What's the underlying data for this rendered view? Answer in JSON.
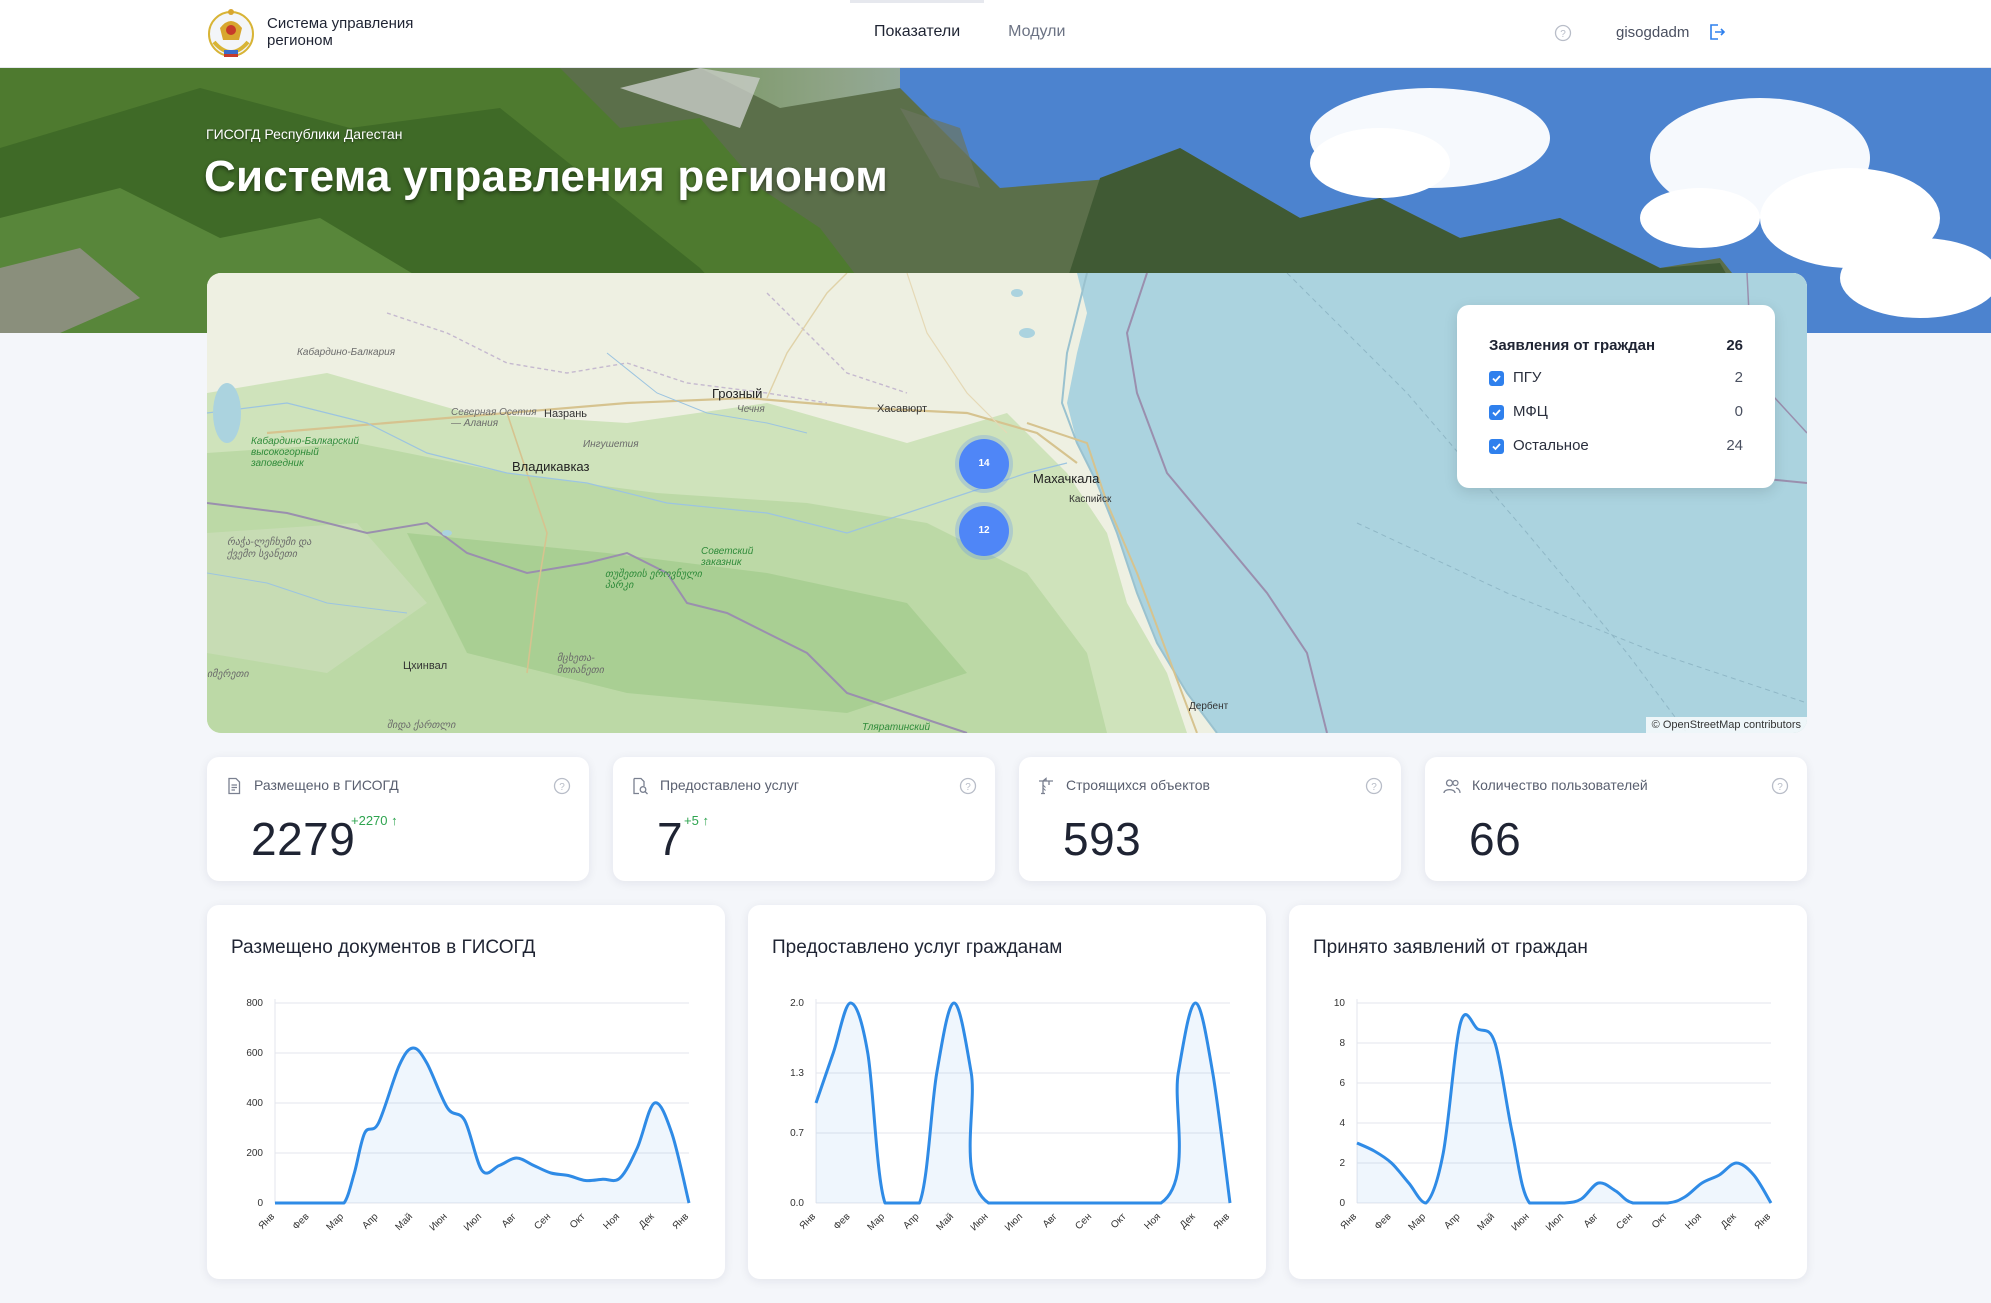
{
  "header": {
    "app_name": "Система управления регионом",
    "nav": [
      {
        "label": "Показатели",
        "active": true
      },
      {
        "label": "Модули",
        "active": false
      }
    ],
    "username": "gisogdadm",
    "icons": {
      "help": "help-circle-icon",
      "logout": "logout-icon",
      "logo": "dagestan-emblem-icon"
    }
  },
  "hero": {
    "subtitle": "ГИСОГД Республики Дагестан",
    "title": "Система управления регионом"
  },
  "map": {
    "labels": {
      "kbr": "Кабардино-Балкария",
      "grozny": "Грозный",
      "chechnya": "Чечня",
      "khasavyurt": "Хасавюрт",
      "nazran": "Назрань",
      "north_ossetia": "Северная Осетия — Алания",
      "ingushetia": "Ингушетия",
      "kbr_reserve": "Кабардино-Балкарский высокогорный заповедник",
      "vladikavkaz": "Владикавказ",
      "makhachkala": "Махачкала",
      "kaspiysk": "Каспийск",
      "sovetsky": "Советский заказник",
      "racha": "რაჭა-ლეჩხუმი და ქვემო სვანეთი",
      "tusheti": "თუშეთის ეროვნული პარკი",
      "mtskheta": "მცხეთა-მთიანეთი",
      "tskhinval": "Цхинвал",
      "imereti": "იმერეთი",
      "shida_kartli": "შიდა ქართლი",
      "derbent": "Дербент",
      "tlyaratinsky": "Тляратинский"
    },
    "clusters": [
      {
        "label": "14"
      },
      {
        "label": "12"
      }
    ],
    "attribution": "© OpenStreetMap contributors",
    "legend": {
      "title": "Заявления от граждан",
      "total": "26",
      "items": [
        {
          "label": "ПГУ",
          "value": "2",
          "checked": true
        },
        {
          "label": "МФЦ",
          "value": "0",
          "checked": true
        },
        {
          "label": "Остальное",
          "value": "24",
          "checked": true
        }
      ]
    }
  },
  "stats": [
    {
      "label": "Размещено в ГИСОГД",
      "value": "2279",
      "delta": "+2270",
      "icon": "document-icon"
    },
    {
      "label": "Предоставлено услуг",
      "value": "7",
      "delta": "+5",
      "icon": "document-search-icon"
    },
    {
      "label": "Строящихся объектов",
      "value": "593",
      "delta": "",
      "icon": "crane-icon"
    },
    {
      "label": "Количество пользователей",
      "value": "66",
      "delta": "",
      "icon": "users-icon"
    }
  ],
  "colors": {
    "accent": "#2f8be6",
    "delta_up": "#2ea44f",
    "cluster": "#4f86f7",
    "checkbox": "#2f80ed"
  },
  "chart_data": [
    {
      "type": "area",
      "title": "Размещено документов в ГИСОГД",
      "categories": [
        "Янв",
        "Фев",
        "Мар",
        "Апр",
        "Май",
        "Июн",
        "Июл",
        "Авг",
        "Сен",
        "Окт",
        "Ноя",
        "Дек",
        "Янв"
      ],
      "x": [
        0,
        1,
        1.6,
        2,
        2.3,
        2.6,
        3,
        3.6,
        4,
        4.4,
        5,
        5.5,
        6,
        6.5,
        7,
        7.5,
        8,
        8.5,
        9,
        9.5,
        10,
        10.5,
        11,
        11.5,
        12
      ],
      "values": [
        0,
        0,
        0,
        0,
        120,
        280,
        320,
        550,
        620,
        560,
        380,
        330,
        130,
        150,
        180,
        150,
        120,
        110,
        90,
        95,
        100,
        220,
        400,
        280,
        0
      ],
      "yticks": [
        "0",
        "200",
        "400",
        "600",
        "800"
      ],
      "ylim": [
        0,
        800
      ],
      "grid": true
    },
    {
      "type": "area",
      "title": "Предоставлено услуг гражданам",
      "categories": [
        "Янв",
        "Фев",
        "Мар",
        "Апр",
        "Май",
        "Июн",
        "Июл",
        "Авг",
        "Сен",
        "Окт",
        "Ноя",
        "Дек",
        "Янв"
      ],
      "x": [
        0,
        0.5,
        1,
        1.5,
        2,
        3,
        3.5,
        4,
        4.5,
        5,
        10,
        10.5,
        11,
        11.5,
        12
      ],
      "values": [
        1,
        1.5,
        2,
        1.5,
        0,
        0,
        1.3,
        2,
        1.3,
        0,
        0,
        1.3,
        2,
        1.3,
        0
      ],
      "yticks": [
        "0.0",
        "0.7",
        "1.3",
        "2.0"
      ],
      "ylim": [
        0,
        2
      ],
      "grid": true
    },
    {
      "type": "area",
      "title": "Принято заявлений от граждан",
      "categories": [
        "Янв",
        "Фев",
        "Мар",
        "Апр",
        "Май",
        "Июн",
        "Июл",
        "Авг",
        "Сен",
        "Окт",
        "Ноя",
        "Дек",
        "Янв"
      ],
      "x": [
        0,
        0.5,
        1,
        1.5,
        2,
        2.5,
        3,
        3.5,
        4,
        4.5,
        5,
        6,
        6.5,
        7,
        7.5,
        8,
        9,
        9.5,
        10,
        10.5,
        11,
        11.5,
        12
      ],
      "values": [
        3,
        2.6,
        2,
        1,
        0,
        2.5,
        9,
        8.7,
        8,
        3.5,
        0,
        0,
        0.2,
        1,
        0.6,
        0,
        0,
        0.3,
        1,
        1.4,
        2,
        1.4,
        0
      ],
      "yticks": [
        "0",
        "2",
        "4",
        "6",
        "8",
        "10"
      ],
      "ylim": [
        0,
        10
      ],
      "grid": true
    }
  ]
}
